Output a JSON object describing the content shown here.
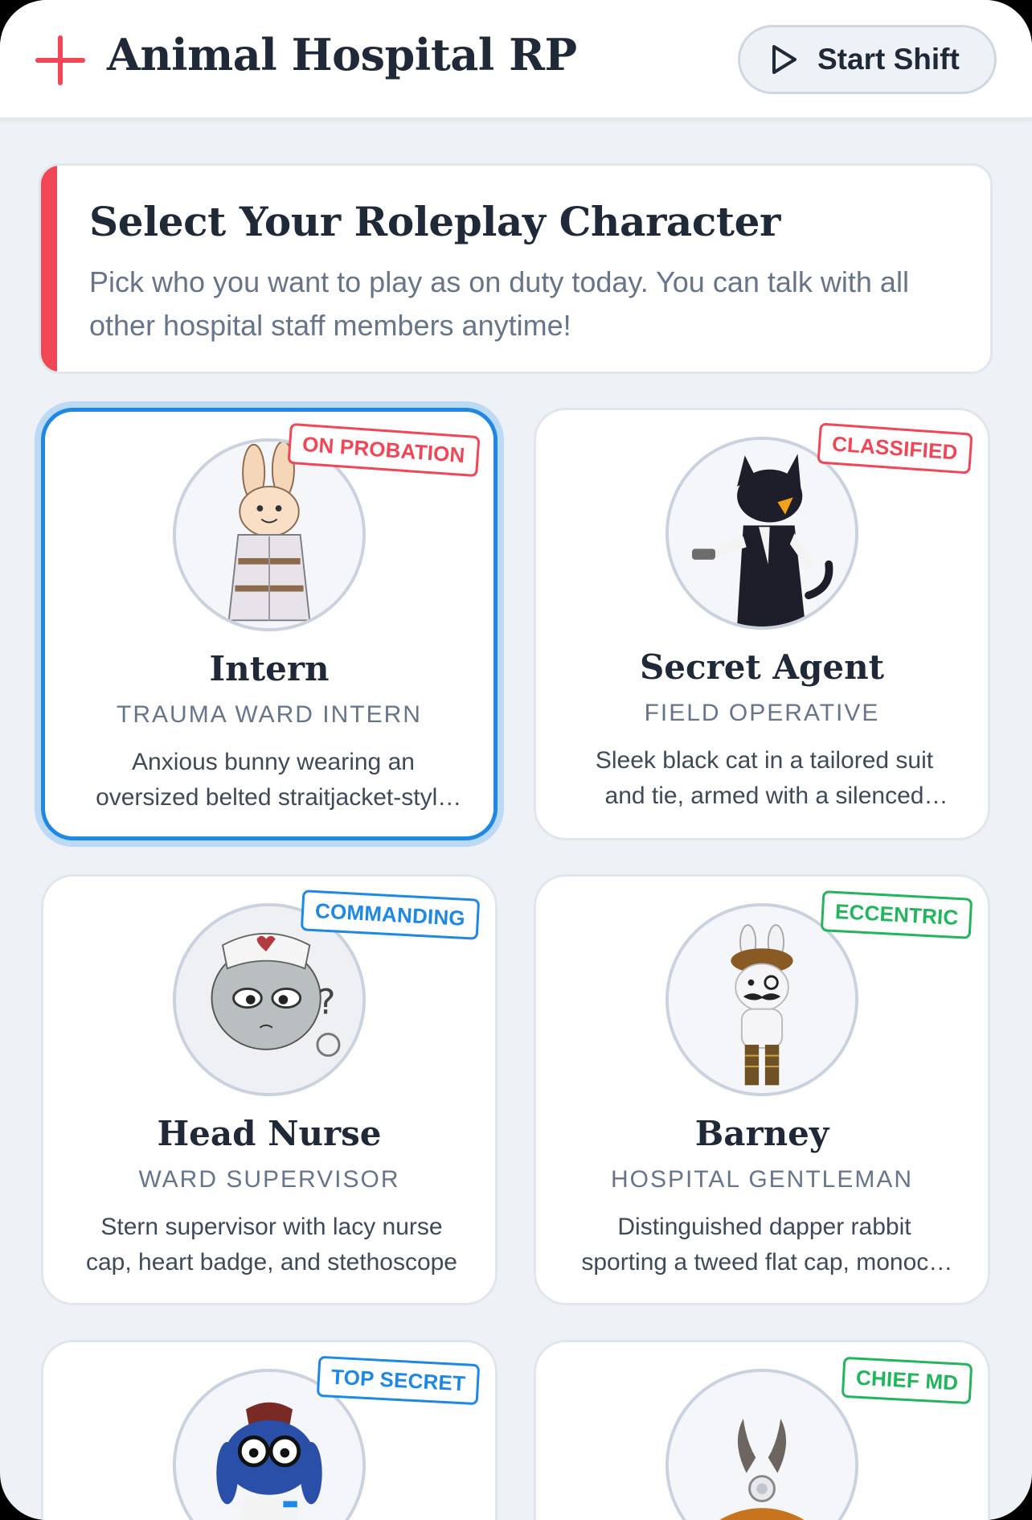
{
  "header": {
    "title": "Animal Hospital RP",
    "start_label": "Start Shift",
    "accent": "#f04656"
  },
  "intro": {
    "title": "Select Your Roleplay Character",
    "text": "Pick who you want to play as on duty today. You can talk with all other hospital staff members anytime!"
  },
  "characters": [
    {
      "name": "Intern",
      "role": "TRAUMA WARD INTERN",
      "badge": "ON PROBATION",
      "badge_color": "red",
      "description": "Anxious bunny wearing an oversized belted straitjacket-style outfit",
      "selected": true,
      "avatar_icon": "bunny-avatar-icon"
    },
    {
      "name": "Secret Agent",
      "role": "FIELD OPERATIVE",
      "badge": "CLASSIFIED",
      "badge_color": "red",
      "description": "Sleek black cat in a tailored suit and tie, armed with a silenced pistol",
      "selected": false,
      "avatar_icon": "cat-avatar-icon"
    },
    {
      "name": "Head Nurse",
      "role": "WARD SUPERVISOR",
      "badge": "COMMANDING",
      "badge_color": "blue",
      "description": "Stern supervisor with lacy nurse cap, heart badge, and stethoscope",
      "selected": false,
      "avatar_icon": "nurse-avatar-icon"
    },
    {
      "name": "Barney",
      "role": "HOSPITAL GENTLEMAN",
      "badge": "ECCENTRIC",
      "badge_color": "green",
      "description": "Distinguished dapper rabbit sporting a tweed flat cap, monocle and mustache",
      "selected": false,
      "avatar_icon": "rabbit-avatar-icon"
    },
    {
      "name": "",
      "role": "",
      "badge": "TOP SECRET",
      "badge_color": "blue",
      "description": "",
      "selected": false,
      "avatar_icon": "blue-dog-avatar-icon"
    },
    {
      "name": "",
      "role": "",
      "badge": "CHIEF MD",
      "badge_color": "green",
      "description": "",
      "selected": false,
      "avatar_icon": "antler-avatar-icon"
    }
  ]
}
